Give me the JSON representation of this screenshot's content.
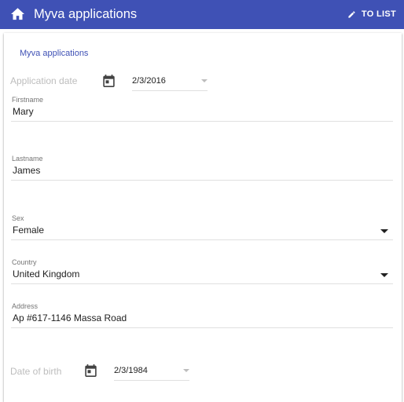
{
  "toolbar": {
    "home_icon": "home-icon",
    "title": "Myva applications",
    "to_list_icon": "pencil-icon",
    "to_list_label": "TO LIST",
    "background_color": "#3f51b5"
  },
  "form": {
    "card_title": "Myva applications",
    "application_date": {
      "label": "Application date",
      "icon": "calendar-icon",
      "value": "2/3/2016"
    },
    "firstname": {
      "label": "Firstname",
      "value": "Mary"
    },
    "lastname": {
      "label": "Lastname",
      "value": "James"
    },
    "sex": {
      "label": "Sex",
      "value": "Female"
    },
    "country": {
      "label": "Country",
      "value": "United Kingdom"
    },
    "address": {
      "label": "Address",
      "value": "Ap #617-1146 Massa Road"
    },
    "date_of_birth": {
      "label": "Date of birth",
      "icon": "calendar-icon",
      "value": "2/3/1984"
    }
  }
}
